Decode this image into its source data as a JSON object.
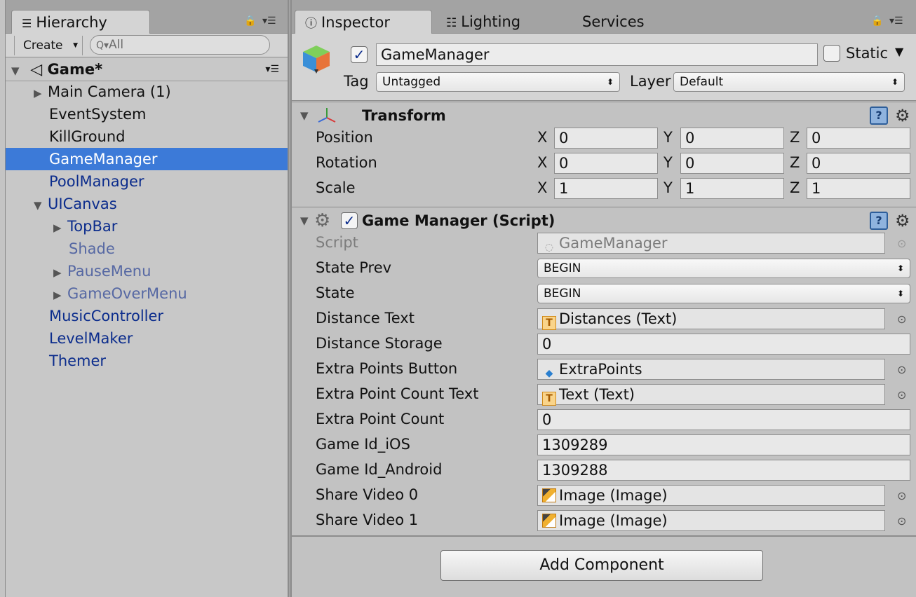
{
  "hierarchy": {
    "tab_label": "Hierarchy",
    "create_label": "Create",
    "search_placeholder": "All",
    "scene_name": "Game*",
    "items": [
      {
        "label": "Main Camera (1)"
      },
      {
        "label": "EventSystem"
      },
      {
        "label": "KillGround"
      },
      {
        "label": "GameManager"
      },
      {
        "label": "PoolManager"
      },
      {
        "label": "UICanvas"
      },
      {
        "label": "TopBar"
      },
      {
        "label": "Shade"
      },
      {
        "label": "PauseMenu"
      },
      {
        "label": "GameOverMenu"
      },
      {
        "label": "MusicController"
      },
      {
        "label": "LevelMaker"
      },
      {
        "label": "Themer"
      }
    ]
  },
  "inspector": {
    "tabs": [
      "Inspector",
      "Lighting",
      "Services"
    ],
    "object_name": "GameManager",
    "static_label": "Static",
    "tag_label": "Tag",
    "tag_value": "Untagged",
    "layer_label": "Layer",
    "layer_value": "Default",
    "transform": {
      "title": "Transform",
      "axes": [
        "X",
        "Y",
        "Z"
      ],
      "rows": [
        {
          "label": "Position",
          "values": [
            "0",
            "0",
            "0"
          ]
        },
        {
          "label": "Rotation",
          "values": [
            "0",
            "0",
            "0"
          ]
        },
        {
          "label": "Scale",
          "values": [
            "1",
            "1",
            "1"
          ]
        }
      ]
    },
    "script": {
      "title": "Game Manager (Script)",
      "fields": [
        {
          "label": "Script",
          "value": "GameManager"
        },
        {
          "label": "State Prev",
          "value": "BEGIN"
        },
        {
          "label": "State",
          "value": "BEGIN"
        },
        {
          "label": "Distance Text",
          "value": "Distances (Text)"
        },
        {
          "label": "Distance Storage",
          "value": "0"
        },
        {
          "label": "Extra Points Button",
          "value": "ExtraPoints"
        },
        {
          "label": "Extra Point Count Text",
          "value": "Text (Text)"
        },
        {
          "label": "Extra Point Count",
          "value": "0"
        },
        {
          "label": "Game Id_iOS",
          "value": "1309289"
        },
        {
          "label": "Game Id_Android",
          "value": "1309288"
        },
        {
          "label": "Share Video 0",
          "value": "Image (Image)"
        },
        {
          "label": "Share Video 1",
          "value": "Image (Image)"
        }
      ]
    },
    "add_component_label": "Add Component"
  },
  "colors": {
    "selection": "#3c7ad8",
    "prefab_text": "#0b2c8c",
    "inactive_prefab_text": "#5668a3"
  }
}
